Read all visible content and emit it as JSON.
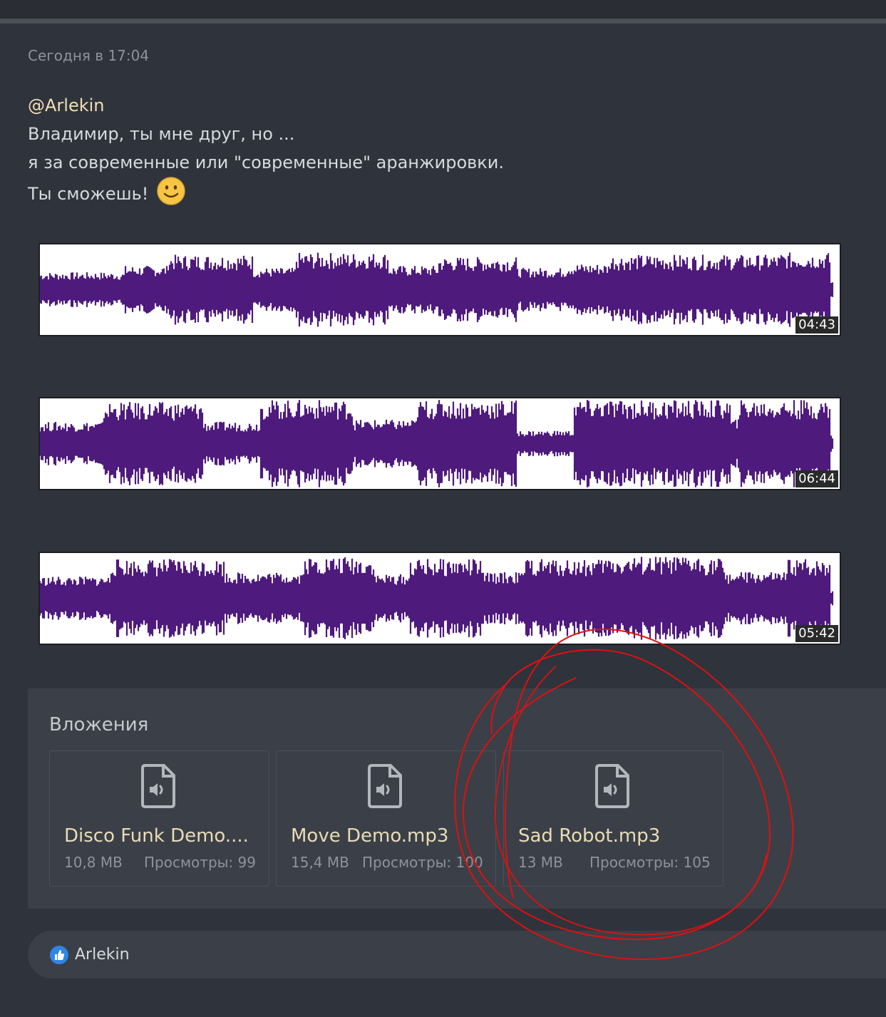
{
  "post": {
    "time": "Сегодня в 17:04",
    "mention": "@Arlekin",
    "lines": [
      "Владимир, ты мне друг, но ...",
      "я за современные или \"современные\" аранжировки.",
      "Ты сможешь!"
    ],
    "smiley": "smiley-face-icon"
  },
  "audio_players": [
    {
      "duration": "04:43"
    },
    {
      "duration": "06:44"
    },
    {
      "duration": "05:42"
    }
  ],
  "attachments": {
    "title": "Вложения",
    "files": [
      {
        "name": "Disco Funk Demo....",
        "size": "10,8 MB",
        "views": "Просмотры: 99",
        "icon": "audio-file-icon"
      },
      {
        "name": "Move Demo.mp3",
        "size": "15,4 MB",
        "views": "Просмотры: 100",
        "icon": "audio-file-icon"
      },
      {
        "name": "Sad Robot.mp3",
        "size": "13 MB",
        "views": "Просмотры: 105",
        "icon": "audio-file-icon"
      }
    ]
  },
  "reactions": {
    "icon": "thumbs-up-icon",
    "user": "Arlekin"
  },
  "colors": {
    "waveform": "#4e1a7d",
    "annotation": "#e01010",
    "mention": "#f0dfb2",
    "file_name": "#e9dcb6"
  }
}
